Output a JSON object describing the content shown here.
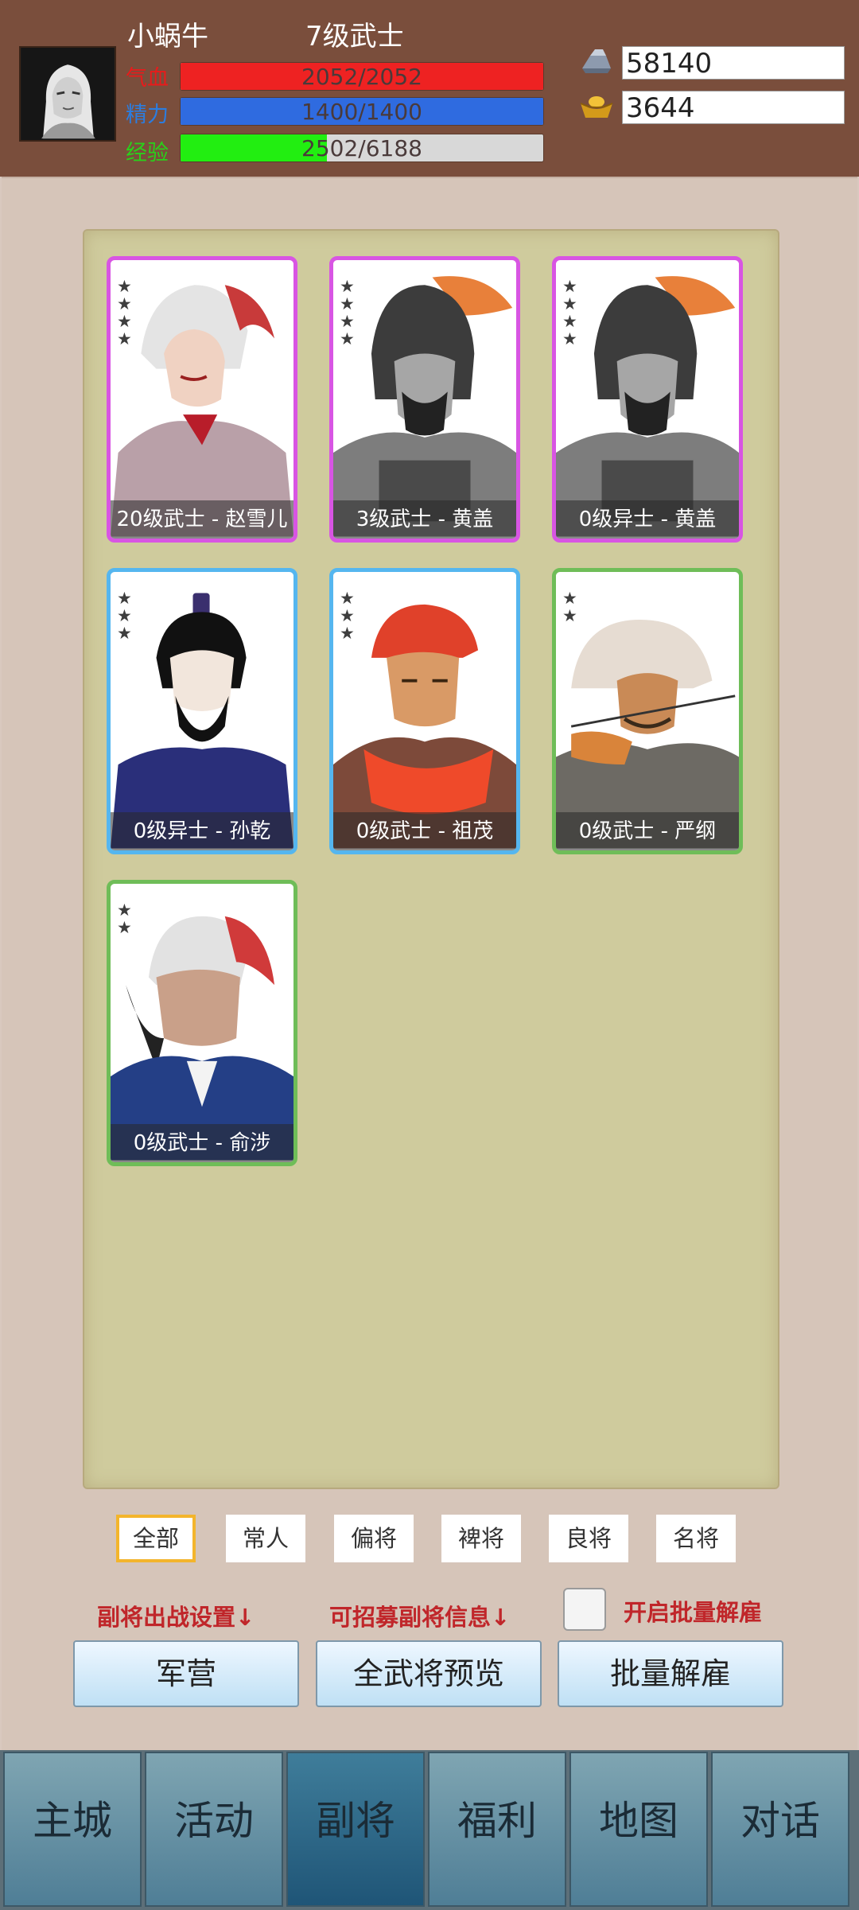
{
  "player": {
    "name": "小蜗牛",
    "rank": "7级武士",
    "hp": {
      "label": "气血",
      "text": "2052/2052",
      "fraction": 1.0,
      "color": "#ee2222"
    },
    "mp": {
      "label": "精力",
      "text": "1400/1400",
      "fraction": 1.0,
      "color": "#2f6be0"
    },
    "exp": {
      "label": "经验",
      "text": "2502/6188",
      "fraction": 0.404,
      "color": "#22ee11"
    }
  },
  "resources": {
    "silver": {
      "icon": "silver-ingot-icon",
      "value": "58140"
    },
    "gold": {
      "icon": "gold-ingot-icon",
      "value": "3644"
    }
  },
  "cards": [
    {
      "label": "20级武士 - 赵雪儿",
      "stars": 4,
      "rarity": "purple"
    },
    {
      "label": "3级武士 - 黄盖",
      "stars": 4,
      "rarity": "purple"
    },
    {
      "label": "0级异士 - 黄盖",
      "stars": 4,
      "rarity": "purple"
    },
    {
      "label": "0级异士 - 孙乾",
      "stars": 3,
      "rarity": "blue"
    },
    {
      "label": "0级武士 - 祖茂",
      "stars": 3,
      "rarity": "blue"
    },
    {
      "label": "0级武士 - 严纲",
      "stars": 2,
      "rarity": "green"
    },
    {
      "label": "0级武士 - 俞涉",
      "stars": 2,
      "rarity": "green"
    }
  ],
  "filters": {
    "all": "全部",
    "common": "常人",
    "partial": "偏将",
    "minor": "裨将",
    "good": "良将",
    "famous": "名将",
    "active": "全部"
  },
  "hints": {
    "deploy": "副将出战设置↓",
    "recruit": "可招募副将信息↓",
    "batch": "开启批量解雇"
  },
  "buttons": {
    "camp": "军营",
    "preview": "全武将预览",
    "dismiss": "批量解雇"
  },
  "nav": {
    "city": "主城",
    "events": "活动",
    "generals": "副将",
    "welfare": "福利",
    "map": "地图",
    "dialog": "对话",
    "active": "副将"
  }
}
